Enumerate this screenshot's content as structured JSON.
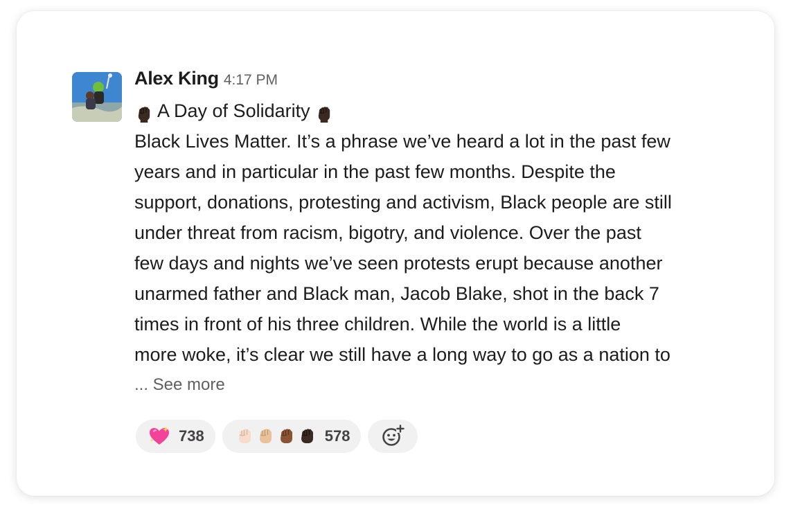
{
  "message": {
    "author": "Alex King",
    "time": "4:17 PM",
    "title": "A Day of Solidarity",
    "title_emoji": "raised-fist-dark-skin-icon",
    "body": "Black Lives Matter. It’s a phrase we’ve heard a lot in the past few\nyears and in particular in the past few months. Despite the\nsupport, donations, protesting and activism, Black people are still\nunder threat from racism, bigotry, and violence. Over the past\nfew days and nights we’ve seen protests erupt because another\nunarmed father and Black man, Jacob Blake, shot in the back 7\ntimes in front of his three children. While the world is a little\nmore woke, it’s clear we still have a long way to go as a nation to",
    "see_more": "... See more"
  },
  "reactions": [
    {
      "emoji": "sparkling-heart-icon",
      "count": "738"
    },
    {
      "emoji": "raised-fists-skin-tones-icon",
      "count": "578"
    }
  ],
  "add_reaction_icon": "add-reaction-icon",
  "colors": {
    "text": "#1d1c1d",
    "muted": "#616061",
    "pill_bg": "#f1f1f1"
  }
}
